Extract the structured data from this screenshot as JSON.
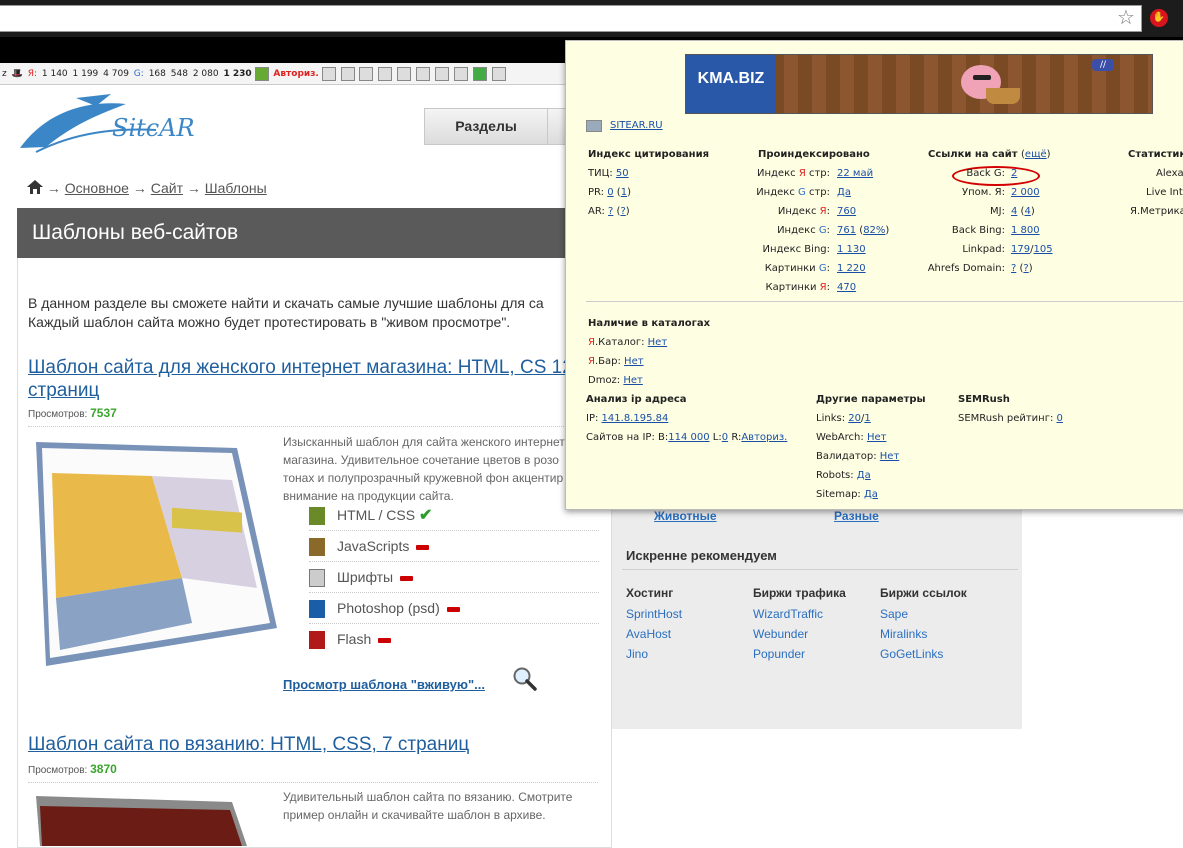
{
  "seobar": {
    "items": [
      "Я:",
      "1 140",
      "1 199",
      "4 709",
      "G:",
      "168",
      "548",
      "2 080",
      "1 230",
      "Авториз."
    ],
    "left_label": "z"
  },
  "nav": {
    "sections": "Разделы"
  },
  "breadcrumb": {
    "arrow": "→",
    "home": "Основное",
    "site": "Сайт",
    "current": "Шаблоны"
  },
  "header": {
    "title": "Шаблоны веб-сайтов"
  },
  "intro": "В данном разделе вы сможете найти и скачать самые лучшие шаблоны для са Каждый шаблон сайта можно будет протестировать в \"живом просмотре\".",
  "templates": [
    {
      "title": "Шаблон сайта для женского интернет магазина: HTML, CS 12 страниц",
      "views_label": "Просмотров:",
      "views": "7537",
      "desc": "Изысканный шаблон для сайта женского интернет магазина. Удивительное сочетание цветов в розо тонах и полупрозрачный кружевной фон акцентир внимание на продукции сайта.",
      "features": [
        "HTML / CSS",
        "JavaScripts",
        "Шрифты",
        "Photoshop (psd)",
        "Flash"
      ],
      "preview_link": "Просмотр шаблона \"вживую\"..."
    },
    {
      "title": "Шаблон сайта по вязанию: HTML, CSS, 7 страниц",
      "views_label": "Просмотров:",
      "views": "3870",
      "desc": "Удивительный шаблон сайта по вязанию. Смотрите пример онлайн и скачивайте шаблон в архиве."
    }
  ],
  "sidebar": {
    "cats": [
      "Животные",
      "Разные"
    ],
    "recommend_title": "Искренне рекомендуем",
    "columns": [
      {
        "title": "Хостинг",
        "links": [
          "SprintHost",
          "AvaHost",
          "Jino"
        ]
      },
      {
        "title": "Биржи трафика",
        "links": [
          "WizardTraffic",
          "Webunder",
          "Popunder"
        ]
      },
      {
        "title": "Биржи ссылок",
        "links": [
          "Sape",
          "Miralinks",
          "GoGetLinks"
        ]
      }
    ]
  },
  "popup": {
    "banner_logo": "KMA.BIZ",
    "site": "SITEAR.RU",
    "h_index": "Индекс цитирования",
    "h_indexed": "Проиндексировано",
    "h_links": "Ссылки на сайт",
    "h_links_more": "ещё",
    "h_stats": "Статистик",
    "tic_label": "ТИЦ:",
    "tic_val": "50",
    "pr_label": "PR:",
    "pr_val": "0",
    "pr_val2": "1",
    "ar_label": "AR:",
    "ar_val": "?",
    "ar_val2": "?",
    "idx_ya_str_label": "стр:",
    "idx_ya_str_val": "22 май",
    "idx_g_str_label": "стр:",
    "idx_g_str_val": "Да",
    "idx_ya_label": "Индекс",
    "idx_ya_val": "760",
    "idx_g_val": "761",
    "idx_g_pct": "82%",
    "idx_bing_label": "Индекс Bing:",
    "idx_bing_val": "1 130",
    "pics_g_label": "Картинки",
    "pics_g_val": "1 220",
    "pics_ya_val": "470",
    "back_g_label": "Back G:",
    "back_g_val": "2",
    "upom_label": "Упом. Я:",
    "upom_val": "2 000",
    "mj_label": "MJ:",
    "mj_val": "4",
    "mj_val2": "4",
    "back_bing_label": "Back Bing:",
    "back_bing_val": "1 800",
    "linkpad_label": "Linkpad:",
    "linkpad_val": "179",
    "linkpad_val2": "105",
    "ahrefs_label": "Ahrefs Domain:",
    "ahrefs_val": "?",
    "ahrefs_val2": "?",
    "stat_alexa": "Alexa",
    "stat_live": "Live Int",
    "stat_yam": "Я.Метрика",
    "h_catalogs": "Наличие в каталогах",
    "cat_yacat_label": "Каталог:",
    "cat_yacat_val": "Нет",
    "cat_yabar_label": "Бар:",
    "cat_yabar_val": "Нет",
    "cat_dmoz_label": "Dmoz:",
    "cat_dmoz_val": "Нет",
    "h_ip": "Анализ ip адреса",
    "ip_label": "IP:",
    "ip_val": "141.8.195.84",
    "ipsites_label": "Сайтов на IP:",
    "ipsites_b": "B:",
    "ipsites_b_val": "114 000",
    "ipsites_l": "L:",
    "ipsites_l_val": "0",
    "ipsites_r": "R:",
    "ipsites_r_val": "Авториз.",
    "h_other": "Другие параметры",
    "links_label": "Links:",
    "links_val": "20",
    "links_val2": "1",
    "webarch_label": "WebArch:",
    "webarch_val": "Нет",
    "valid_label": "Валидатор:",
    "valid_val": "Нет",
    "robots_label": "Robots:",
    "robots_val": "Да",
    "sitemap_label": "Sitemap:",
    "sitemap_val": "Да",
    "h_semrush": "SEMRush",
    "semrush_label": "SEMRush рейтинг:",
    "semrush_val": "0"
  }
}
